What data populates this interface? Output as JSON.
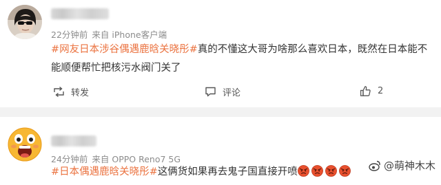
{
  "comments": [
    {
      "time": "22分钟前",
      "source": "来自 iPhone客户端",
      "tag": "#网友日本涉谷偶遇鹿晗关晓彤#",
      "body": "真的不懂这大哥为啥那么喜欢日本，既然在日本能不能顺便帮忙把核污水阀门关了",
      "actions": {
        "repost": "转发",
        "comment": "评论",
        "like_count": "2"
      },
      "avatar_icon": "person-sunglasses-avatar"
    },
    {
      "time": "24分钟前",
      "source": "来自 OPPO Reno7 5G",
      "tag": "#日本偶遇鹿晗关晓彤#",
      "body": "这俩货如果再去鬼子国直接开喷",
      "emoji_icon": "angry-face-emoji",
      "emoji_count": 4,
      "avatar_icon": "screaming-emoji-avatar"
    }
  ],
  "watermark": {
    "text": "@萌神木木",
    "icon": "weibo-logo-icon"
  },
  "colors": {
    "tag": "#eb7340",
    "meta": "#8c8c8c",
    "divider": "#f2f2f2"
  }
}
